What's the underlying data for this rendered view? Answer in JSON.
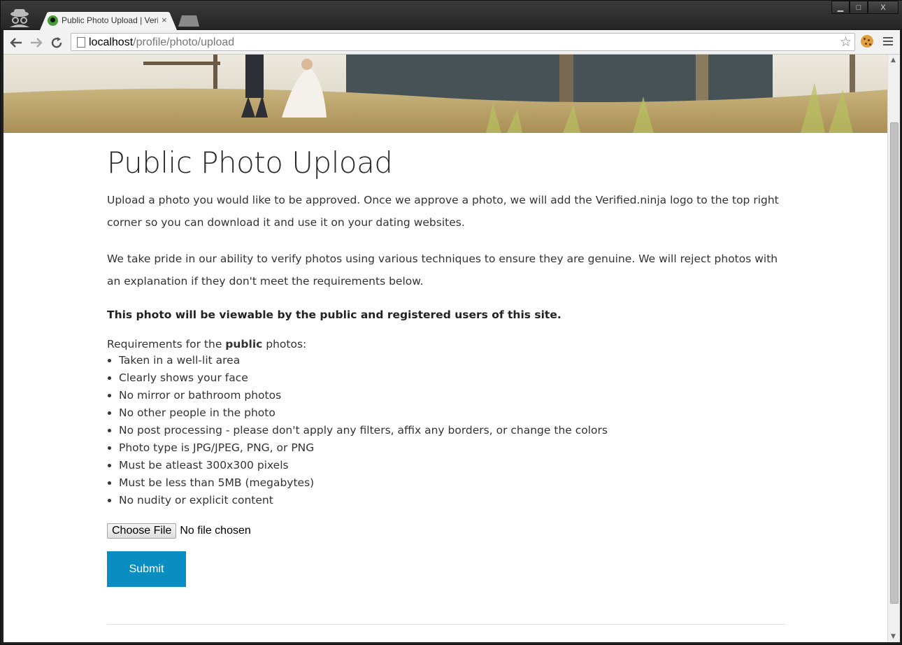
{
  "browser": {
    "tab_title": "Public Photo Upload | Veri",
    "tab_close": "×",
    "url_host": "localhost",
    "url_path": "/profile/photo/upload",
    "window_buttons": {
      "min": "▁",
      "max": "□",
      "close": "X"
    }
  },
  "page": {
    "title": "Public Photo Upload",
    "paragraph1": "Upload a photo you would like to be approved. Once we approve a photo, we will add the Verified.ninja logo to the top right corner so you can download it and use it on your dating websites.",
    "paragraph2": "We take pride in our ability to verify photos using various techniques to ensure they are genuine. We will reject photos with an explanation if they don't meet the requirements below.",
    "notice": "This photo will be viewable by the public and registered users of this site.",
    "requirements_prefix": "Requirements for the ",
    "requirements_bold": "public",
    "requirements_suffix": " photos:",
    "requirements": [
      "Taken in a well-lit area",
      "Clearly shows your face",
      "No mirror or bathroom photos",
      "No other people in the photo",
      "No post processing - please don't apply any filters, affix any borders, or change the colors",
      "Photo type is JPG/JPEG, PNG, or PNG",
      "Must be atleast 300x300 pixels",
      "Must be less than 5MB (megabytes)",
      "No nudity or explicit content"
    ],
    "choose_file_label": "Choose File",
    "no_file_text": "No file chosen",
    "submit_label": "Submit"
  },
  "colors": {
    "submit_bg": "#0a8ec2",
    "text": "#333333"
  }
}
